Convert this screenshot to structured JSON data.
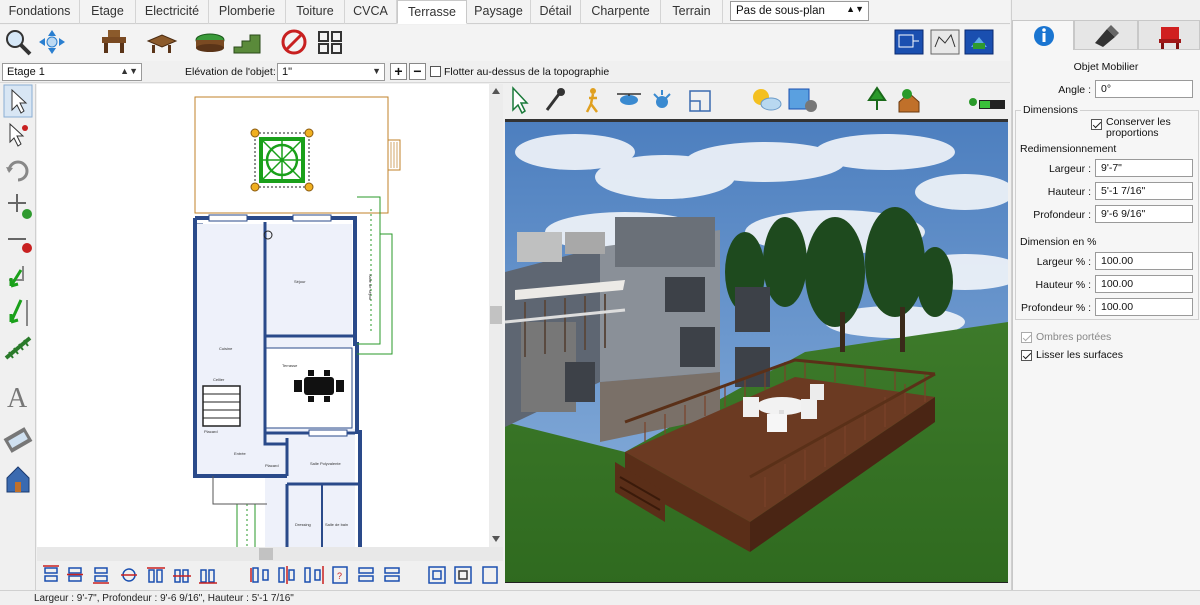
{
  "tabs": [
    {
      "label": "Fondations",
      "active": false
    },
    {
      "label": "Etage",
      "active": false
    },
    {
      "label": "Electricité",
      "active": false
    },
    {
      "label": "Plomberie",
      "active": false
    },
    {
      "label": "Toiture",
      "active": false
    },
    {
      "label": "CVCA",
      "active": false
    },
    {
      "label": "Terrasse",
      "active": true
    },
    {
      "label": "Paysage",
      "active": false
    },
    {
      "label": "Détail",
      "active": false
    },
    {
      "label": "Charpente",
      "active": false
    },
    {
      "label": "Terrain",
      "active": false
    }
  ],
  "subplan_select": {
    "value": "Pas de sous-plan"
  },
  "level_row": {
    "level_value": "Etage 1",
    "elevation_label": "Elévation de l'objet:",
    "elevation_value": "1\"",
    "float_label": "Flotter au-dessus de la topographie",
    "float_checked": false
  },
  "plan_labels": {
    "sejour": "Séjour",
    "cuisine": "Cuisine",
    "terrasse": "Terrasse",
    "entree": "Entrée",
    "salle_polyvalente": "Salle Polyvalente",
    "dressing": "Dressing",
    "salle_de_bain": "Salle de bain",
    "cellier": "Cellier",
    "placard1": "Placard",
    "placard2": "Placard",
    "balcon": "Salle de séjour"
  },
  "right_panel": {
    "tabs": [
      "info-icon",
      "pen-icon",
      "chair-icon"
    ],
    "title": "Objet Mobilier",
    "angle_label": "Angle :",
    "angle_value": "0°",
    "dimensions_header": "Dimensions",
    "keep_proportions_label": "Conserver les proportions",
    "keep_proportions_checked": true,
    "resize_header": "Redimensionnement",
    "width_label": "Largeur :",
    "width_value": "9'-7\"",
    "height_label": "Hauteur :",
    "height_value": "5'-1 7/16\"",
    "depth_label": "Profondeur :",
    "depth_value": "9'-6 9/16\"",
    "percent_header": "Dimension en %",
    "width_pct_label": "Largeur % :",
    "width_pct_value": "100.00",
    "height_pct_label": "Hauteur % :",
    "height_pct_value": "100.00",
    "depth_pct_label": "Profondeur % :",
    "depth_pct_value": "100.00",
    "shadows_label": "Ombres portées",
    "shadows_checked": true,
    "smooth_label": "Lisser les surfaces",
    "smooth_checked": true
  },
  "status_bar": "Largeur : 9'-7\", Profondeur : 9'-6 9/16\", Hauteur : 5'-1 7/16\"",
  "colors": {
    "accent": "#1a75d1",
    "green": "#2f9a2f",
    "deck": "#6b3a22",
    "wall": "#2a4a8a"
  }
}
